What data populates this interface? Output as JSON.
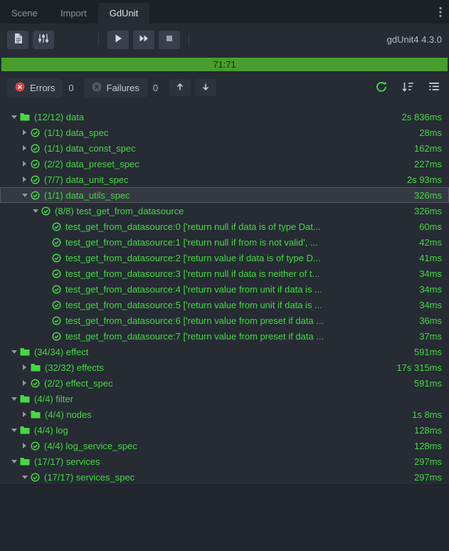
{
  "colors": {
    "success_green": "#45d943",
    "error_red": "#e04545",
    "progress_green": "#479e2d"
  },
  "tabbar": {
    "tabs": [
      {
        "label": "Scene"
      },
      {
        "label": "Import"
      },
      {
        "label": "GdUnit"
      }
    ]
  },
  "toolbar": {
    "version": "gdUnit4 4.3.0"
  },
  "progress": {
    "label": "71:71"
  },
  "statusbar": {
    "errors_label": "Errors",
    "errors_count": "0",
    "failures_label": "Failures",
    "failures_count": "0"
  },
  "tree": {
    "rows": [
      {
        "depth": 0,
        "icon": "folder",
        "chevron": "open",
        "label": "(12/12) data",
        "time": "2s 836ms"
      },
      {
        "depth": 1,
        "icon": "suite",
        "chevron": "closed",
        "label": "(1/1) data_spec",
        "time": "28ms"
      },
      {
        "depth": 1,
        "icon": "suite",
        "chevron": "closed",
        "label": "(1/1) data_const_spec",
        "time": "162ms"
      },
      {
        "depth": 1,
        "icon": "suite",
        "chevron": "closed",
        "label": "(2/2) data_preset_spec",
        "time": "227ms"
      },
      {
        "depth": 1,
        "icon": "suite",
        "chevron": "closed",
        "label": "(7/7) data_unit_spec",
        "time": "2s 93ms"
      },
      {
        "depth": 1,
        "icon": "suite",
        "chevron": "open",
        "label": "(1/1) data_utils_spec",
        "time": "326ms",
        "selected": true
      },
      {
        "depth": 2,
        "icon": "suite",
        "chevron": "open",
        "label": "(8/8) test_get_from_datasource",
        "time": "326ms"
      },
      {
        "depth": 3,
        "icon": "test",
        "chevron": "none",
        "label": "test_get_from_datasource:0 ['return null if data is of type Dat...",
        "time": "60ms"
      },
      {
        "depth": 3,
        "icon": "test",
        "chevron": "none",
        "label": "test_get_from_datasource:1 ['return null if from is not valid', ...",
        "time": "42ms"
      },
      {
        "depth": 3,
        "icon": "test",
        "chevron": "none",
        "label": "test_get_from_datasource:2 ['return value if data is of type D...",
        "time": "41ms"
      },
      {
        "depth": 3,
        "icon": "test",
        "chevron": "none",
        "label": "test_get_from_datasource:3 ['return null if data is neither of t...",
        "time": "34ms"
      },
      {
        "depth": 3,
        "icon": "test",
        "chevron": "none",
        "label": "test_get_from_datasource:4 ['return value from unit if data is ...",
        "time": "34ms"
      },
      {
        "depth": 3,
        "icon": "test",
        "chevron": "none",
        "label": "test_get_from_datasource:5 ['return value from unit if data is ...",
        "time": "34ms"
      },
      {
        "depth": 3,
        "icon": "test",
        "chevron": "none",
        "label": "test_get_from_datasource:6 ['return value from preset if data ...",
        "time": "36ms"
      },
      {
        "depth": 3,
        "icon": "test",
        "chevron": "none",
        "label": "test_get_from_datasource:7 ['return value from preset if data ...",
        "time": "37ms"
      },
      {
        "depth": 0,
        "icon": "folder",
        "chevron": "open",
        "label": "(34/34) effect",
        "time": "591ms"
      },
      {
        "depth": 1,
        "icon": "folder",
        "chevron": "closed",
        "label": "(32/32) effects",
        "time": "17s 315ms"
      },
      {
        "depth": 1,
        "icon": "suite",
        "chevron": "closed",
        "label": "(2/2) effect_spec",
        "time": "591ms"
      },
      {
        "depth": 0,
        "icon": "folder",
        "chevron": "open",
        "label": "(4/4) filter",
        "time": ""
      },
      {
        "depth": 1,
        "icon": "folder",
        "chevron": "closed",
        "label": "(4/4) nodes",
        "time": "1s 8ms"
      },
      {
        "depth": 0,
        "icon": "folder",
        "chevron": "open",
        "label": "(4/4) log",
        "time": "128ms"
      },
      {
        "depth": 1,
        "icon": "suite",
        "chevron": "closed",
        "label": "(4/4) log_service_spec",
        "time": "128ms"
      },
      {
        "depth": 0,
        "icon": "folder",
        "chevron": "open",
        "label": "(17/17) services",
        "time": "297ms"
      },
      {
        "depth": 1,
        "icon": "suite",
        "chevron": "open",
        "label": "(17/17) services_spec",
        "time": "297ms"
      }
    ]
  }
}
